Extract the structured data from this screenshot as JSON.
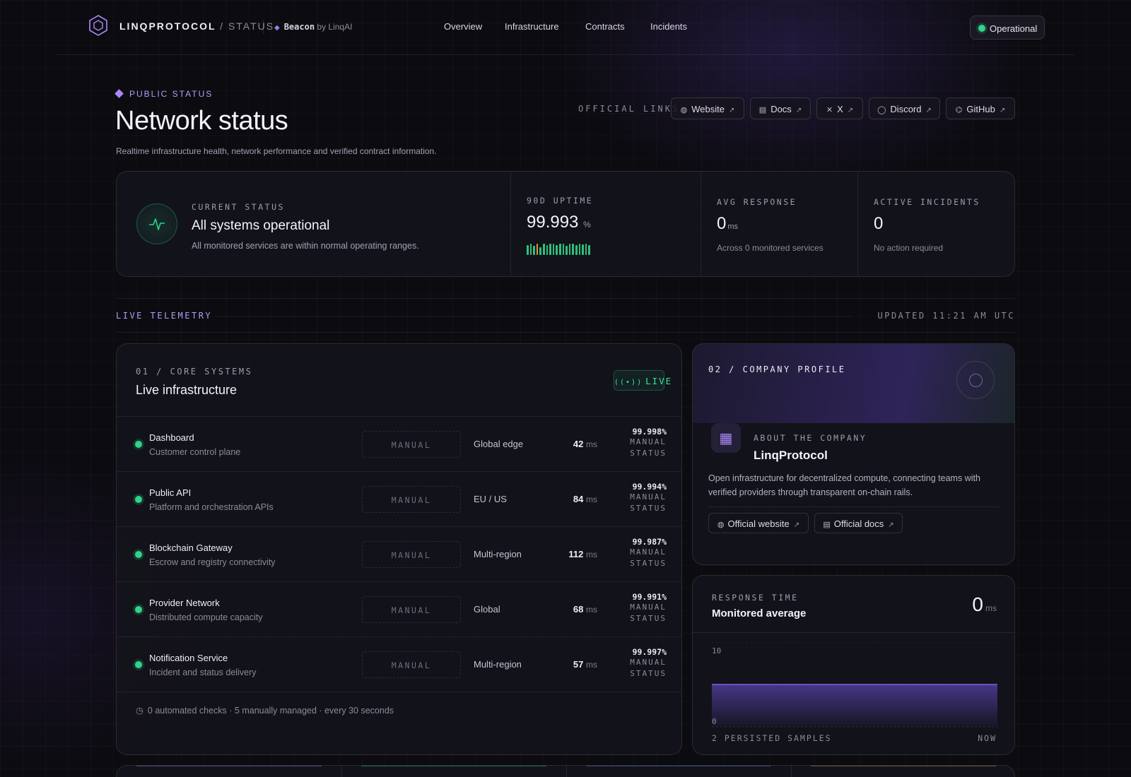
{
  "header": {
    "brand": "LINQPROTOCOL",
    "brand_suffix": "/ STATUS",
    "beacon_name": "Beacon",
    "beacon_by": "by LinqAI",
    "nav": [
      "Overview",
      "Infrastructure",
      "Contracts",
      "Incidents"
    ],
    "status_pill": "Operational"
  },
  "hero": {
    "eyebrow": "PUBLIC STATUS",
    "title": "Network status",
    "subtitle": "Realtime infrastructure health, network performance and verified contract information.",
    "official_links_label": "OFFICIAL LINKS",
    "links": [
      {
        "label": "Website",
        "icon": "globe-icon"
      },
      {
        "label": "Docs",
        "icon": "doc-icon"
      },
      {
        "label": "X",
        "icon": "x-icon"
      },
      {
        "label": "Discord",
        "icon": "chat-icon"
      },
      {
        "label": "GitHub",
        "icon": "github-icon"
      }
    ]
  },
  "summary": {
    "current_label": "CURRENT STATUS",
    "current_value": "All systems operational",
    "current_desc": "All monitored services are within normal operating ranges.",
    "uptime_label": "90D UPTIME",
    "uptime_value": "99.993",
    "uptime_unit": "%",
    "uptime_bar_levels": [
      0.9,
      1,
      0.8,
      1,
      0.7,
      1,
      0.85,
      1,
      1,
      0.9,
      1,
      1,
      0.8,
      1,
      1,
      0.9,
      1,
      0.95,
      1,
      0.85
    ],
    "uptime_bar_colors": [
      "#2ec07a",
      "#2ec07a",
      "#2ec07a",
      "#d99a3c",
      "#2ec07a",
      "#2ec07a",
      "#2ec07a",
      "#2ec07a",
      "#2ec07a",
      "#2ec07a",
      "#2ec07a",
      "#2ec07a",
      "#2ec07a",
      "#2ec07a",
      "#2ec07a",
      "#2ec07a",
      "#2ec07a",
      "#2ec07a",
      "#2ec07a",
      "#2ec07a"
    ],
    "avg_label": "AVG RESPONSE",
    "avg_value": "0",
    "avg_unit": "ms",
    "avg_desc": "Across 0 monitored services",
    "incidents_label": "ACTIVE INCIDENTS",
    "incidents_value": "0",
    "incidents_desc": "No action required"
  },
  "telemetry": {
    "label": "LIVE TELEMETRY",
    "updated": "UPDATED 11:21 AM UTC"
  },
  "infra": {
    "eyebrow": "01 / CORE SYSTEMS",
    "title": "Live infrastructure",
    "live_badge": "LIVE",
    "rows": [
      {
        "name": "Dashboard",
        "desc": "Customer control plane",
        "mode": "MANUAL",
        "region": "Global edge",
        "latency": "42",
        "unit": "ms",
        "uptime": "99.998%",
        "status1": "MANUAL",
        "status2": "STATUS"
      },
      {
        "name": "Public API",
        "desc": "Platform and orchestration APIs",
        "mode": "MANUAL",
        "region": "EU / US",
        "latency": "84",
        "unit": "ms",
        "uptime": "99.994%",
        "status1": "MANUAL",
        "status2": "STATUS"
      },
      {
        "name": "Blockchain Gateway",
        "desc": "Escrow and registry connectivity",
        "mode": "MANUAL",
        "region": "Multi-region",
        "latency": "112",
        "unit": "ms",
        "uptime": "99.987%",
        "status1": "MANUAL",
        "status2": "STATUS"
      },
      {
        "name": "Provider Network",
        "desc": "Distributed compute capacity",
        "mode": "MANUAL",
        "region": "Global",
        "latency": "68",
        "unit": "ms",
        "uptime": "99.991%",
        "status1": "MANUAL",
        "status2": "STATUS"
      },
      {
        "name": "Notification Service",
        "desc": "Incident and status delivery",
        "mode": "MANUAL",
        "region": "Multi-region",
        "latency": "57",
        "unit": "ms",
        "uptime": "99.997%",
        "status1": "MANUAL",
        "status2": "STATUS"
      }
    ],
    "footer": "0 automated checks · 5 manually managed · every 30 seconds"
  },
  "company": {
    "eyebrow": "02 / COMPANY PROFILE",
    "about_label": "ABOUT THE COMPANY",
    "name": "LinqProtocol",
    "desc": "Open infrastructure for decentralized compute, connecting teams with verified providers through transparent on-chain rails.",
    "btn_website": "Official website",
    "btn_docs": "Official docs"
  },
  "response": {
    "label": "RESPONSE TIME",
    "title": "Monitored average",
    "value": "0",
    "unit": "ms",
    "footer_left": "2 PERSISTED SAMPLES",
    "footer_right": "NOW"
  },
  "chart_data": {
    "type": "area",
    "x": [
      "",
      "NOW"
    ],
    "series": [
      {
        "values": [
          5,
          5
        ]
      }
    ],
    "ylim": [
      0,
      10
    ],
    "ytick_labels": [
      "10",
      "0"
    ],
    "color": "#7b5cf0"
  },
  "colors": {
    "accent": "#a889f7",
    "ok": "#2ed48a",
    "background": "#0c0b10"
  }
}
